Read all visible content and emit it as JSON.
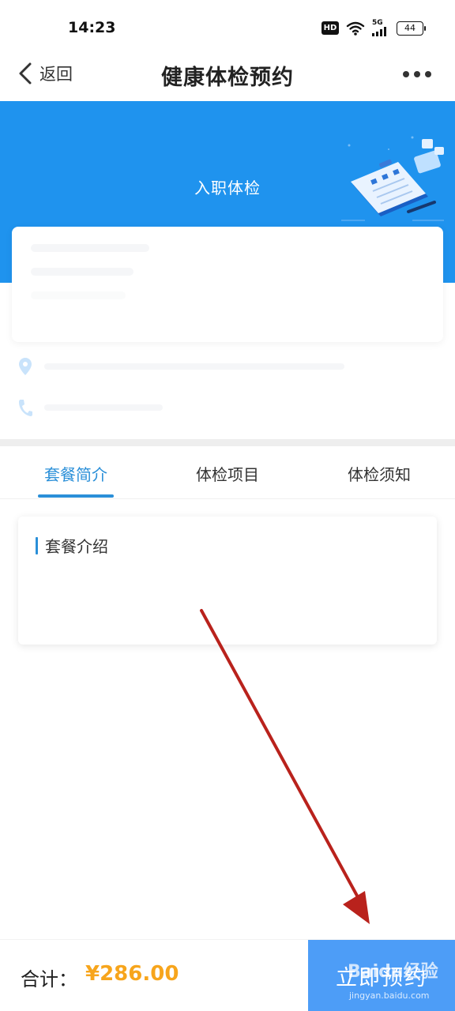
{
  "status_bar": {
    "time": "14:23",
    "hd": "HD",
    "network": "5G",
    "battery": "44"
  },
  "nav": {
    "back_label": "返回",
    "title": "健康体检预约"
  },
  "banner": {
    "title": "入职体检",
    "color": "#1f93ee"
  },
  "tabs": [
    {
      "label": "套餐简介",
      "active": true
    },
    {
      "label": "体检项目",
      "active": false
    },
    {
      "label": "体检须知",
      "active": false
    }
  ],
  "intro": {
    "title": "套餐介绍"
  },
  "footer": {
    "total_label": "合计：",
    "total_price": "¥286.00",
    "book_label": "立即预约",
    "price_color": "#f7a51c",
    "button_color": "#4d9df7"
  },
  "watermark": {
    "text": "Baidu经验",
    "url": "jingyan.baidu.com"
  },
  "icons": {
    "back": "chevron-left-icon",
    "more": "more-dots-icon",
    "location": "location-pin-icon",
    "phone": "phone-icon",
    "wifi": "wifi-icon",
    "signal": "signal-icon"
  }
}
